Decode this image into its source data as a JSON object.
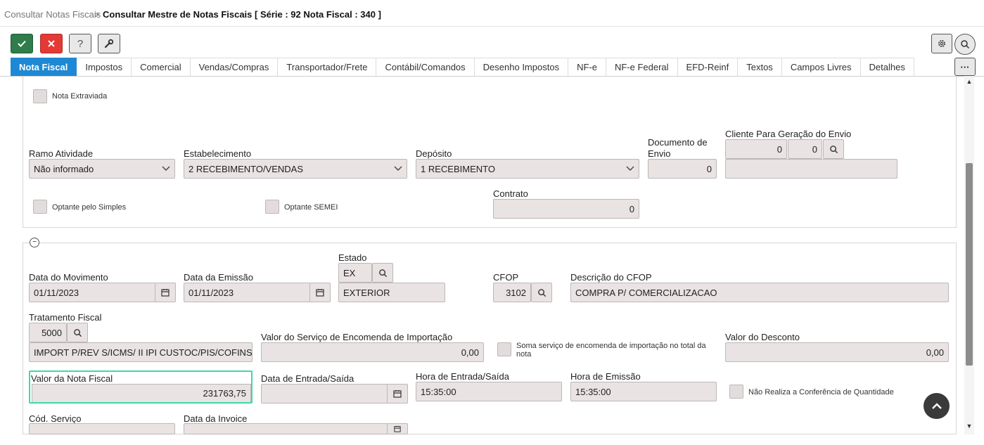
{
  "breadcrumb": {
    "link": "Consultar Notas Fiscais",
    "separator": ">",
    "current": "Consultar Mestre de Notas Fiscais [ Série : 92 Nota Fiscal : 340 ]"
  },
  "toolbar": {
    "help_label": "?"
  },
  "tabs": [
    {
      "label": "Nota Fiscal",
      "active": true
    },
    {
      "label": "Impostos"
    },
    {
      "label": "Comercial"
    },
    {
      "label": "Vendas/Compras"
    },
    {
      "label": "Transportador/Frete"
    },
    {
      "label": "Contábil/Comandos"
    },
    {
      "label": "Desenho Impostos"
    },
    {
      "label": "NF-e"
    },
    {
      "label": "NF-e Federal"
    },
    {
      "label": "EFD-Reinf"
    },
    {
      "label": "Textos"
    },
    {
      "label": "Campos Livres"
    },
    {
      "label": "Detalhes"
    }
  ],
  "more_label": "···",
  "section1": {
    "nota_extraviada": "Nota Extraviada",
    "ramo_atividade": {
      "label": "Ramo Atividade",
      "value": "Não informado"
    },
    "estabelecimento": {
      "label": "Estabelecimento",
      "value": "2 RECEBIMENTO/VENDAS"
    },
    "deposito": {
      "label": "Depósito",
      "value": "1 RECEBIMENTO"
    },
    "documento_envio": {
      "label1": "Documento de",
      "label2": "Envio",
      "value": "0"
    },
    "cliente_envio": {
      "label": "Cliente Para Geração do Envio",
      "value1": "0",
      "value2": "0",
      "name": ""
    },
    "optante_simples": "Optante pelo Simples",
    "optante_semei": "Optante SEMEI",
    "contrato": {
      "label": "Contrato",
      "value": "0"
    }
  },
  "section2": {
    "data_movimento": {
      "label": "Data do Movimento",
      "value": "01/11/2023"
    },
    "data_emissao": {
      "label": "Data da Emissão",
      "value": "01/11/2023"
    },
    "estado": {
      "label": "Estado",
      "code": "EX",
      "name": "EXTERIOR"
    },
    "cfop": {
      "label": "CFOP",
      "value": "3102"
    },
    "descricao_cfop": {
      "label": "Descrição do CFOP",
      "value": "COMPRA P/ COMERCIALIZACAO"
    },
    "tratamento_fiscal": {
      "label": "Tratamento Fiscal",
      "code": "5000",
      "description": "IMPORT P/REV S/ICMS/ II IPI CUSTOC/PIS/COFINS PNEU"
    },
    "valor_servico_encomenda": {
      "label": "Valor do Serviço de Encomenda de Importação",
      "value": "0,00"
    },
    "soma_servico": "Soma serviço de encomenda de importação no total da nota",
    "valor_desconto": {
      "label": "Valor do Desconto",
      "value": "0,00"
    },
    "valor_nota_fiscal": {
      "label": "Valor da Nota Fiscal",
      "value": "231763,75"
    },
    "data_entrada_saida": {
      "label": "Data de Entrada/Saída",
      "value": ""
    },
    "hora_entrada_saida": {
      "label": "Hora de Entrada/Saída",
      "value": "15:35:00"
    },
    "hora_emissao": {
      "label": "Hora de Emissão",
      "value": "15:35:00"
    },
    "nao_realiza_conferencia": "Não Realiza a Conferência de Quantidade",
    "cod_servico": {
      "label": "Cód. Serviço",
      "value": ""
    },
    "data_invoice": {
      "label": "Data da Invoice",
      "value": ""
    }
  }
}
